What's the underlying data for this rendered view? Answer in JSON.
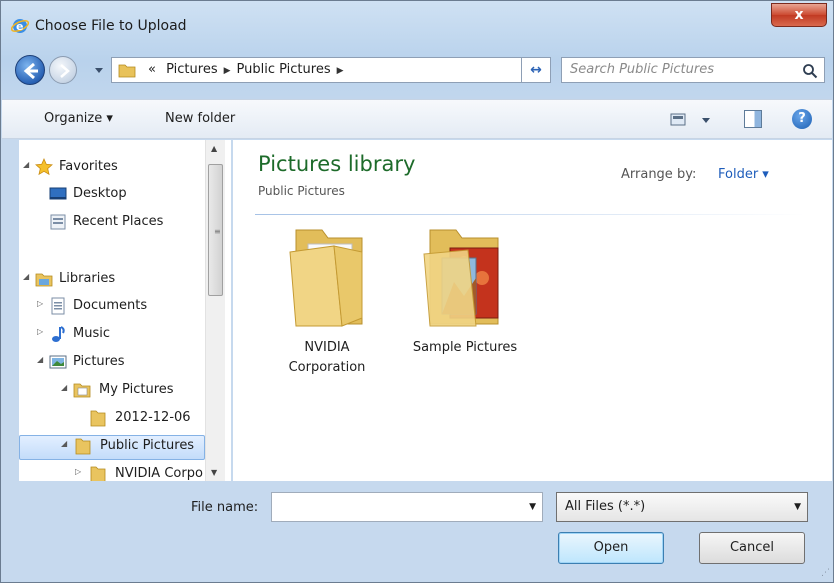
{
  "window": {
    "title": "Choose File to Upload",
    "close_label": "x"
  },
  "nav": {
    "breadcrumb_prefix": "«",
    "breadcrumbs": [
      "Pictures",
      "Public Pictures"
    ],
    "search_placeholder": "Search Public Pictures"
  },
  "toolbar": {
    "organize_label": "Organize ▾",
    "new_folder_label": "New folder",
    "help_label": "?"
  },
  "sidebar": {
    "items": [
      {
        "label": "Favorites",
        "icon": "star-icon"
      },
      {
        "label": "Desktop",
        "icon": "desktop-icon"
      },
      {
        "label": "Recent Places",
        "icon": "recent-places-icon"
      },
      {
        "label": "Libraries",
        "icon": "libraries-icon"
      },
      {
        "label": "Documents",
        "icon": "documents-icon"
      },
      {
        "label": "Music",
        "icon": "music-icon"
      },
      {
        "label": "Pictures",
        "icon": "pictures-icon"
      },
      {
        "label": "My Pictures",
        "icon": "pictures-folder-icon"
      },
      {
        "label": "2012-12-06",
        "icon": "folder-icon"
      },
      {
        "label": "Public Pictures",
        "icon": "folder-icon",
        "selected": true
      },
      {
        "label": "NVIDIA Corpo",
        "icon": "folder-icon"
      }
    ]
  },
  "content": {
    "library_title": "Pictures library",
    "library_subtitle": "Public Pictures",
    "arrange_by_label": "Arrange by:",
    "arrange_by_value": "Folder ▾",
    "folders": [
      {
        "name_line1": "NVIDIA",
        "name_line2": "Corporation",
        "icon": "folder-documents-icon"
      },
      {
        "name_line1": "Sample Pictures",
        "name_line2": "",
        "icon": "folder-pictures-icon"
      }
    ]
  },
  "footer": {
    "file_name_label": "File name:",
    "file_name_value": "",
    "filter_value": "All Files (*.*)",
    "open_label": "Open",
    "cancel_label": "Cancel"
  },
  "colors": {
    "accent": "#1e5dbb",
    "library_title": "#1d6b2a",
    "selection": "#c3dcfa"
  }
}
